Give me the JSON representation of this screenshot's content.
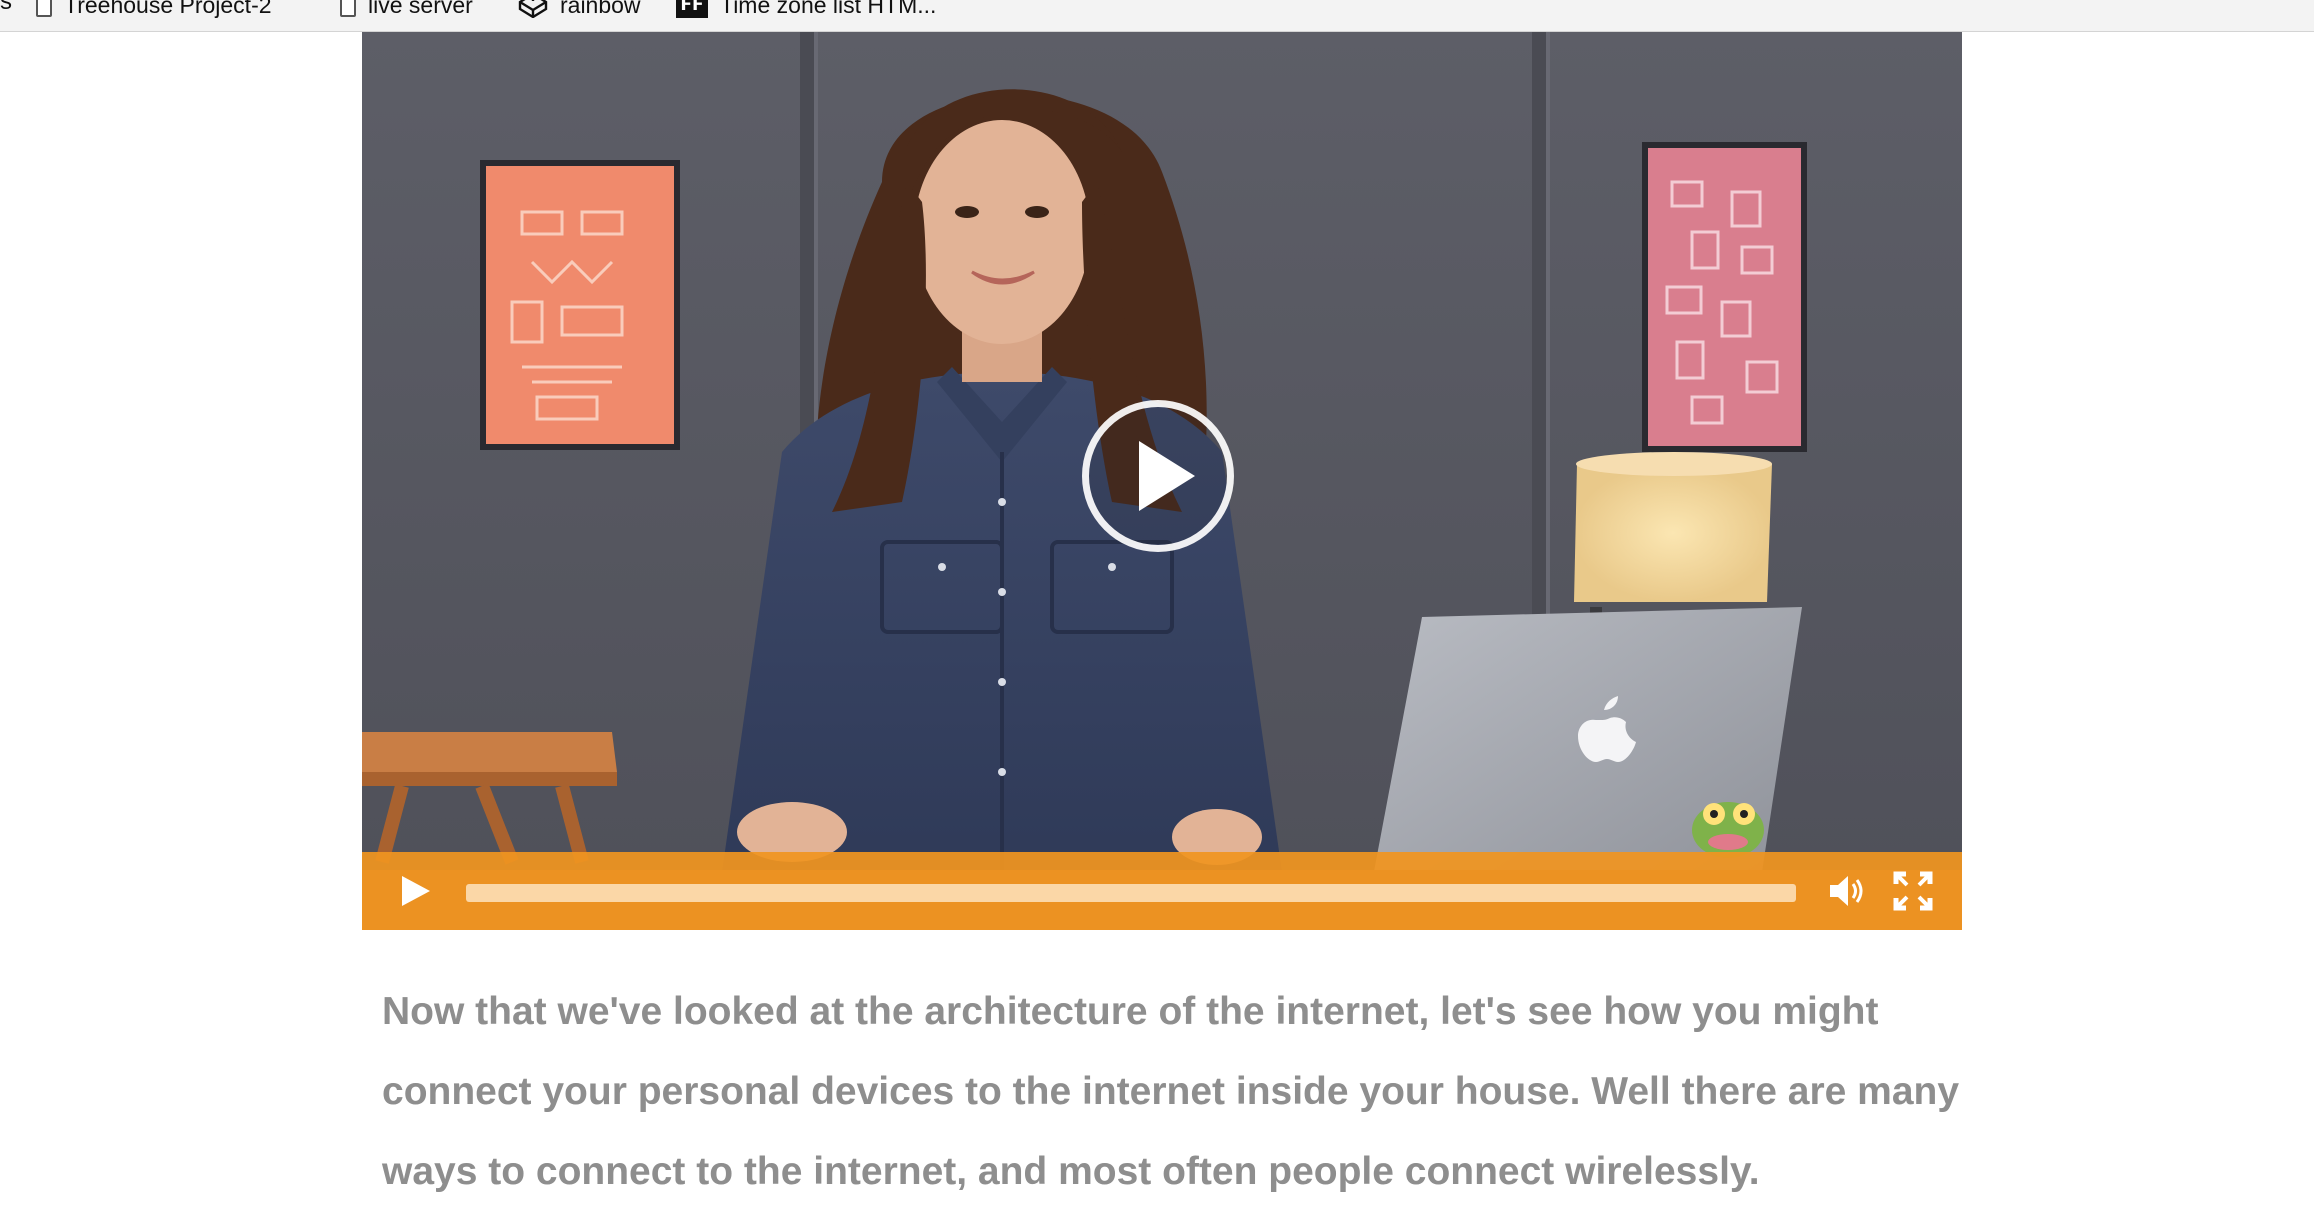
{
  "bookmarks_bar": {
    "cut_item_label": "s",
    "items": [
      {
        "label": "Treehouse Project-2",
        "icon": "file-icon"
      },
      {
        "label": "live server",
        "icon": "file-icon"
      },
      {
        "label": "rainbow",
        "icon": "codepen-icon"
      },
      {
        "label": "Time zone list HTM...",
        "icon": "ff-badge-icon",
        "icon_text": "FF"
      }
    ]
  },
  "video_player": {
    "controls": {
      "play": "play-icon",
      "volume": "volume-icon",
      "fullscreen": "fullscreen-icon"
    },
    "progress": 0,
    "accent_color": "#f0941f"
  },
  "transcript": {
    "lines": [
      "Now that we've looked at the architecture of the internet, let's see how you might",
      "connect your personal devices to the internet inside your house. Well there are many",
      "ways to connect to the internet, and most often people connect wirelessly."
    ]
  }
}
